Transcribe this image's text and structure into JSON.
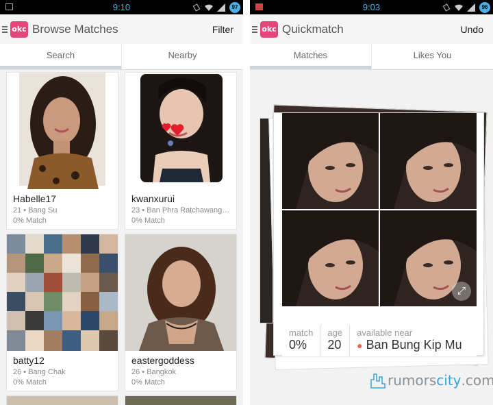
{
  "left": {
    "status_time": "9:10",
    "battery": "97",
    "title": "Browse Matches",
    "action": "Filter",
    "tabs": [
      "Search",
      "Nearby"
    ],
    "cards": [
      {
        "name": "Habelle17",
        "meta": "21 • Bang Su",
        "match": "0% Match"
      },
      {
        "name": "kwanxurui",
        "meta": "23 • Ban Phra Ratchawang ...",
        "match": "0% Match"
      },
      {
        "name": "batty12",
        "meta": "26 • Bang Chak",
        "match": "0% Match"
      },
      {
        "name": "eastergoddess",
        "meta": "26 • Bangkok",
        "match": "0% Match"
      }
    ]
  },
  "right": {
    "status_time": "9:03",
    "battery": "96",
    "title": "Quickmatch",
    "action": "Undo",
    "tabs": [
      "Matches",
      "Likes You"
    ],
    "match_label": "match",
    "match_value": "0%",
    "age_label": "age",
    "age_value": "20",
    "near_label": "available near",
    "near_value": "Ban Bung Kip Mu"
  },
  "logo_text": "okc",
  "watermark": {
    "a": "rumors",
    "b": "city",
    "c": ".com"
  },
  "colors": {
    "accent": "#e6457a",
    "status_icon": "#4ab1e8",
    "pin": "#e8664b",
    "watermark_blue": "#3aa2d8"
  },
  "icons": [
    "menu-icon",
    "okc-logo",
    "expand-icon",
    "location-pin-icon",
    "wifi-icon",
    "signal-icon",
    "battery-icon"
  ]
}
